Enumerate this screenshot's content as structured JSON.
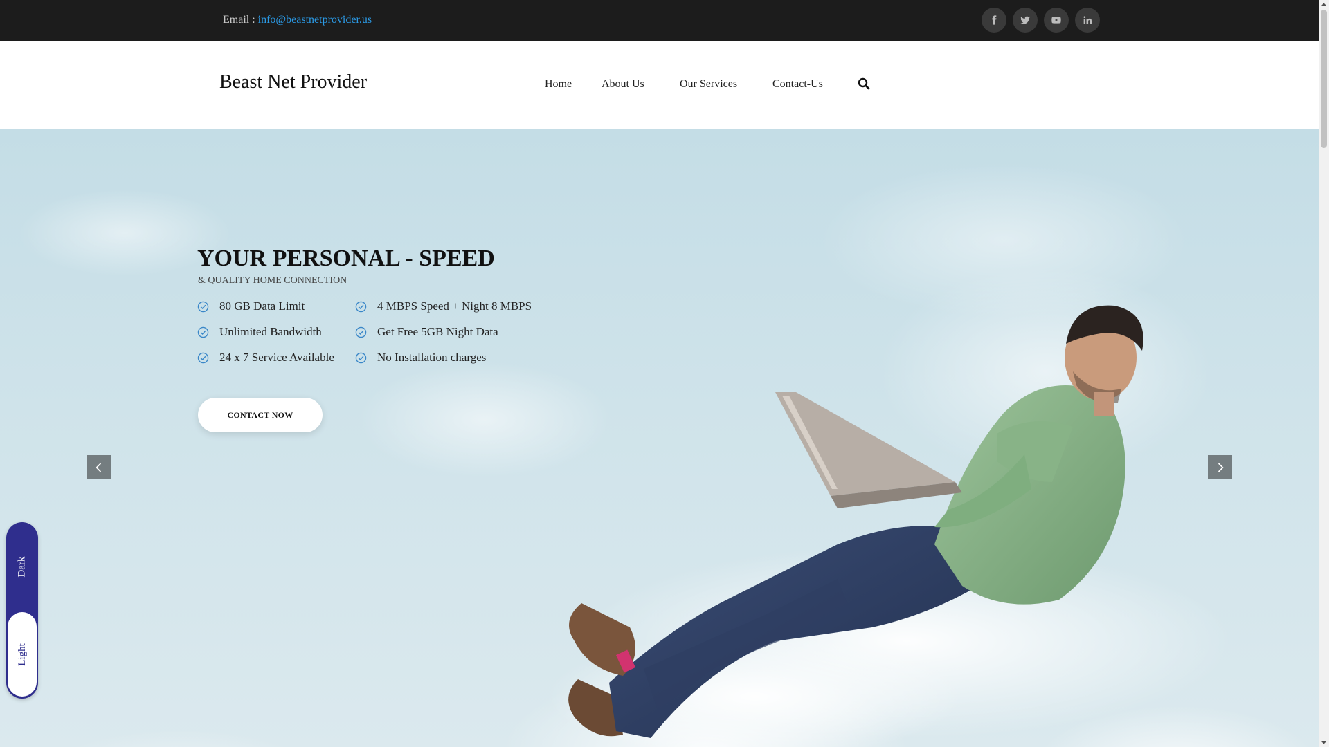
{
  "topbar": {
    "email_label": "Email :",
    "email_value": "info@beastnetprovider.us",
    "social": [
      {
        "icon": "facebook-icon"
      },
      {
        "icon": "twitter-icon"
      },
      {
        "icon": "youtube-icon"
      },
      {
        "icon": "linkedin-icon"
      }
    ]
  },
  "nav": {
    "brand": "Beast Net Provider",
    "items": [
      "Home",
      "About Us",
      "Our Services",
      "Contact-Us"
    ],
    "search_icon": "search-icon"
  },
  "hero": {
    "title": "YOUR PERSONAL - SPEED",
    "subtitle": "& QUALITY HOME CONNECTION",
    "features": [
      "80 GB Data Limit",
      "4 MBPS Speed + Night 8 MBPS",
      "Unlimited Bandwidth",
      "Get Free 5GB Night Data",
      "24 x 7 Service Available",
      "No Installation charges"
    ],
    "cta": "CONTACT NOW",
    "prev_icon": "chevron-left-icon",
    "next_icon": "chevron-right-icon"
  },
  "theme_toggle": {
    "dark": "Dark",
    "light": "Light"
  },
  "colors": {
    "topbar_bg": "#1c1c1c",
    "link": "#2b9ae6",
    "check": "#3a87c8",
    "toggle": "#2f2e8d"
  }
}
